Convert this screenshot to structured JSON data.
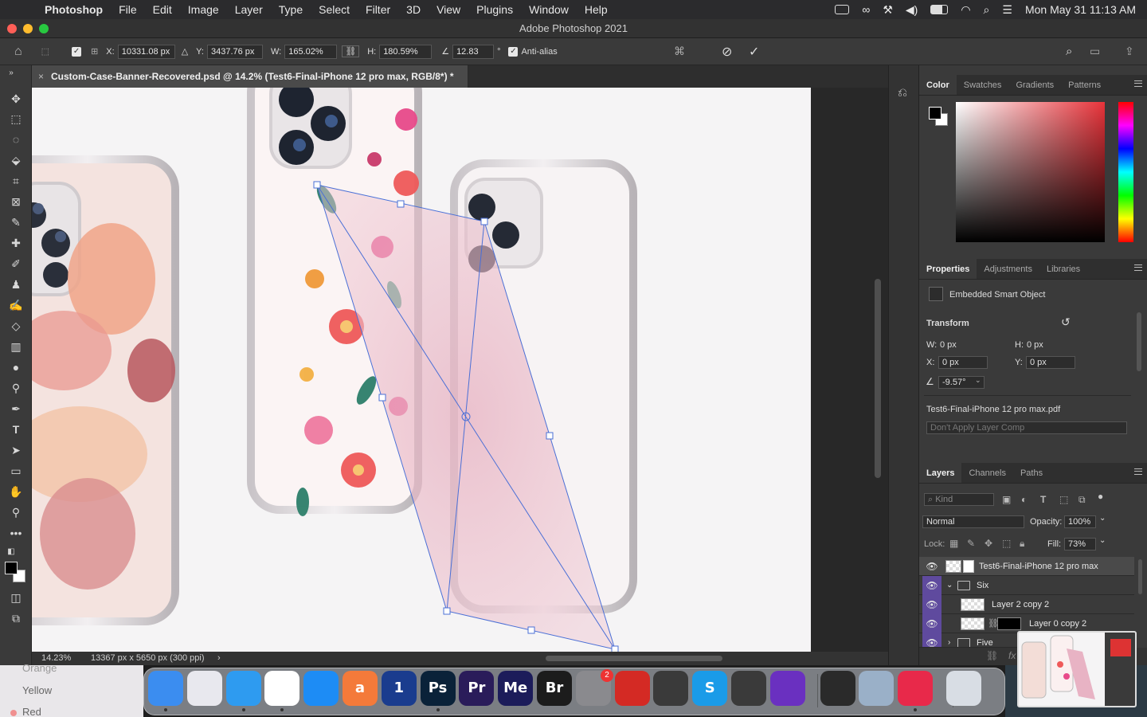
{
  "menubar": {
    "app": "Photoshop",
    "items": [
      "File",
      "Edit",
      "Image",
      "Layer",
      "Type",
      "Select",
      "Filter",
      "3D",
      "View",
      "Plugins",
      "Window",
      "Help"
    ],
    "clock": "Mon May 31  11:13 AM"
  },
  "window": {
    "title": "Adobe Photoshop 2021"
  },
  "options": {
    "x_label": "X:",
    "x_value": "10331.08 px",
    "y_label": "Y:",
    "y_value": "3437.76 px",
    "w_label": "W:",
    "w_value": "165.02%",
    "h_label": "H:",
    "h_value": "180.59%",
    "angle_value": "12.83",
    "angle_unit": "°",
    "antialias_label": "Anti-alias"
  },
  "document": {
    "tab_title": "Custom-Case-Banner-Recovered.psd @ 14.2% (Test6-Final-iPhone 12 pro max, RGB/8*) *",
    "close": "×"
  },
  "status": {
    "zoom": "14.23%",
    "dimensions": "13367 px x 5650 px (300 ppi)",
    "arrow": "›"
  },
  "color_panel": {
    "tabs": [
      "Color",
      "Swatches",
      "Gradients",
      "Patterns"
    ],
    "hue_color": "#e8333a"
  },
  "properties_panel": {
    "tabs": [
      "Properties",
      "Adjustments",
      "Libraries"
    ],
    "type_label": "Embedded Smart Object",
    "transform_label": "Transform",
    "w_label": "W:",
    "w_value": "0 px",
    "h_label": "H:",
    "h_value": "0 px",
    "x_label": "X:",
    "x_value": "0 px",
    "y_label": "Y:",
    "y_value": "0 px",
    "angle_value": "-9.57°",
    "file_name": "Test6-Final-iPhone 12 pro max.pdf",
    "layer_comp": "Don't Apply Layer Comp"
  },
  "layers_panel": {
    "tabs": [
      "Layers",
      "Channels",
      "Paths"
    ],
    "kind_placeholder": "Kind",
    "blend_mode": "Normal",
    "opacity_label": "Opacity:",
    "opacity_value": "100%",
    "lock_label": "Lock:",
    "fill_label": "Fill:",
    "fill_value": "73%",
    "layers": [
      {
        "name": "Test6-Final-iPhone 12 pro max"
      },
      {
        "name": "Six"
      },
      {
        "name": "Layer 2 copy 2"
      },
      {
        "name": "Layer 0 copy 2"
      },
      {
        "name": "Five"
      }
    ]
  },
  "desktop": {
    "items": [
      "Orange",
      "Yellow",
      "Red"
    ]
  },
  "dock": {
    "apps": [
      {
        "name": "Finder",
        "label": "",
        "color": "#3b8df0"
      },
      {
        "name": "Launchpad",
        "label": "",
        "color": "#e8e8ee"
      },
      {
        "name": "Safari",
        "label": "",
        "color": "#2e9bf0"
      },
      {
        "name": "Chrome",
        "label": "",
        "color": "#ffffff"
      },
      {
        "name": "App Store",
        "label": "",
        "color": "#1d8cf5"
      },
      {
        "name": "Aseprite",
        "label": "a",
        "color": "#f47a3a"
      },
      {
        "name": "1Password",
        "label": "1",
        "color": "#1a3c8e"
      },
      {
        "name": "Photoshop",
        "label": "Ps",
        "color": "#0a2239"
      },
      {
        "name": "Premiere",
        "label": "Pr",
        "color": "#2a1c5a"
      },
      {
        "name": "Media Encoder",
        "label": "Me",
        "color": "#1c1c5a"
      },
      {
        "name": "Bridge",
        "label": "Br",
        "color": "#1c1c1c"
      },
      {
        "name": "System Preferences",
        "label": "",
        "color": "#8a8a8e"
      },
      {
        "name": "Acrobat",
        "label": "",
        "color": "#d42a24"
      },
      {
        "name": "Calculator",
        "label": "",
        "color": "#3a3a3a"
      },
      {
        "name": "Skype",
        "label": "S",
        "color": "#1a9be8"
      },
      {
        "name": "Final Cut",
        "label": "",
        "color": "#3a3a3a"
      },
      {
        "name": "Audio",
        "label": "",
        "color": "#6a30c0"
      },
      {
        "name": "QuickTime",
        "label": "",
        "color": "#2a2a2a"
      },
      {
        "name": "Preview",
        "label": "",
        "color": "#9ab0c8"
      },
      {
        "name": "Creative Cloud",
        "label": "",
        "color": "#e8294a"
      },
      {
        "name": "Trash",
        "label": "",
        "color": "#d8dde4"
      }
    ],
    "badge": "2"
  }
}
